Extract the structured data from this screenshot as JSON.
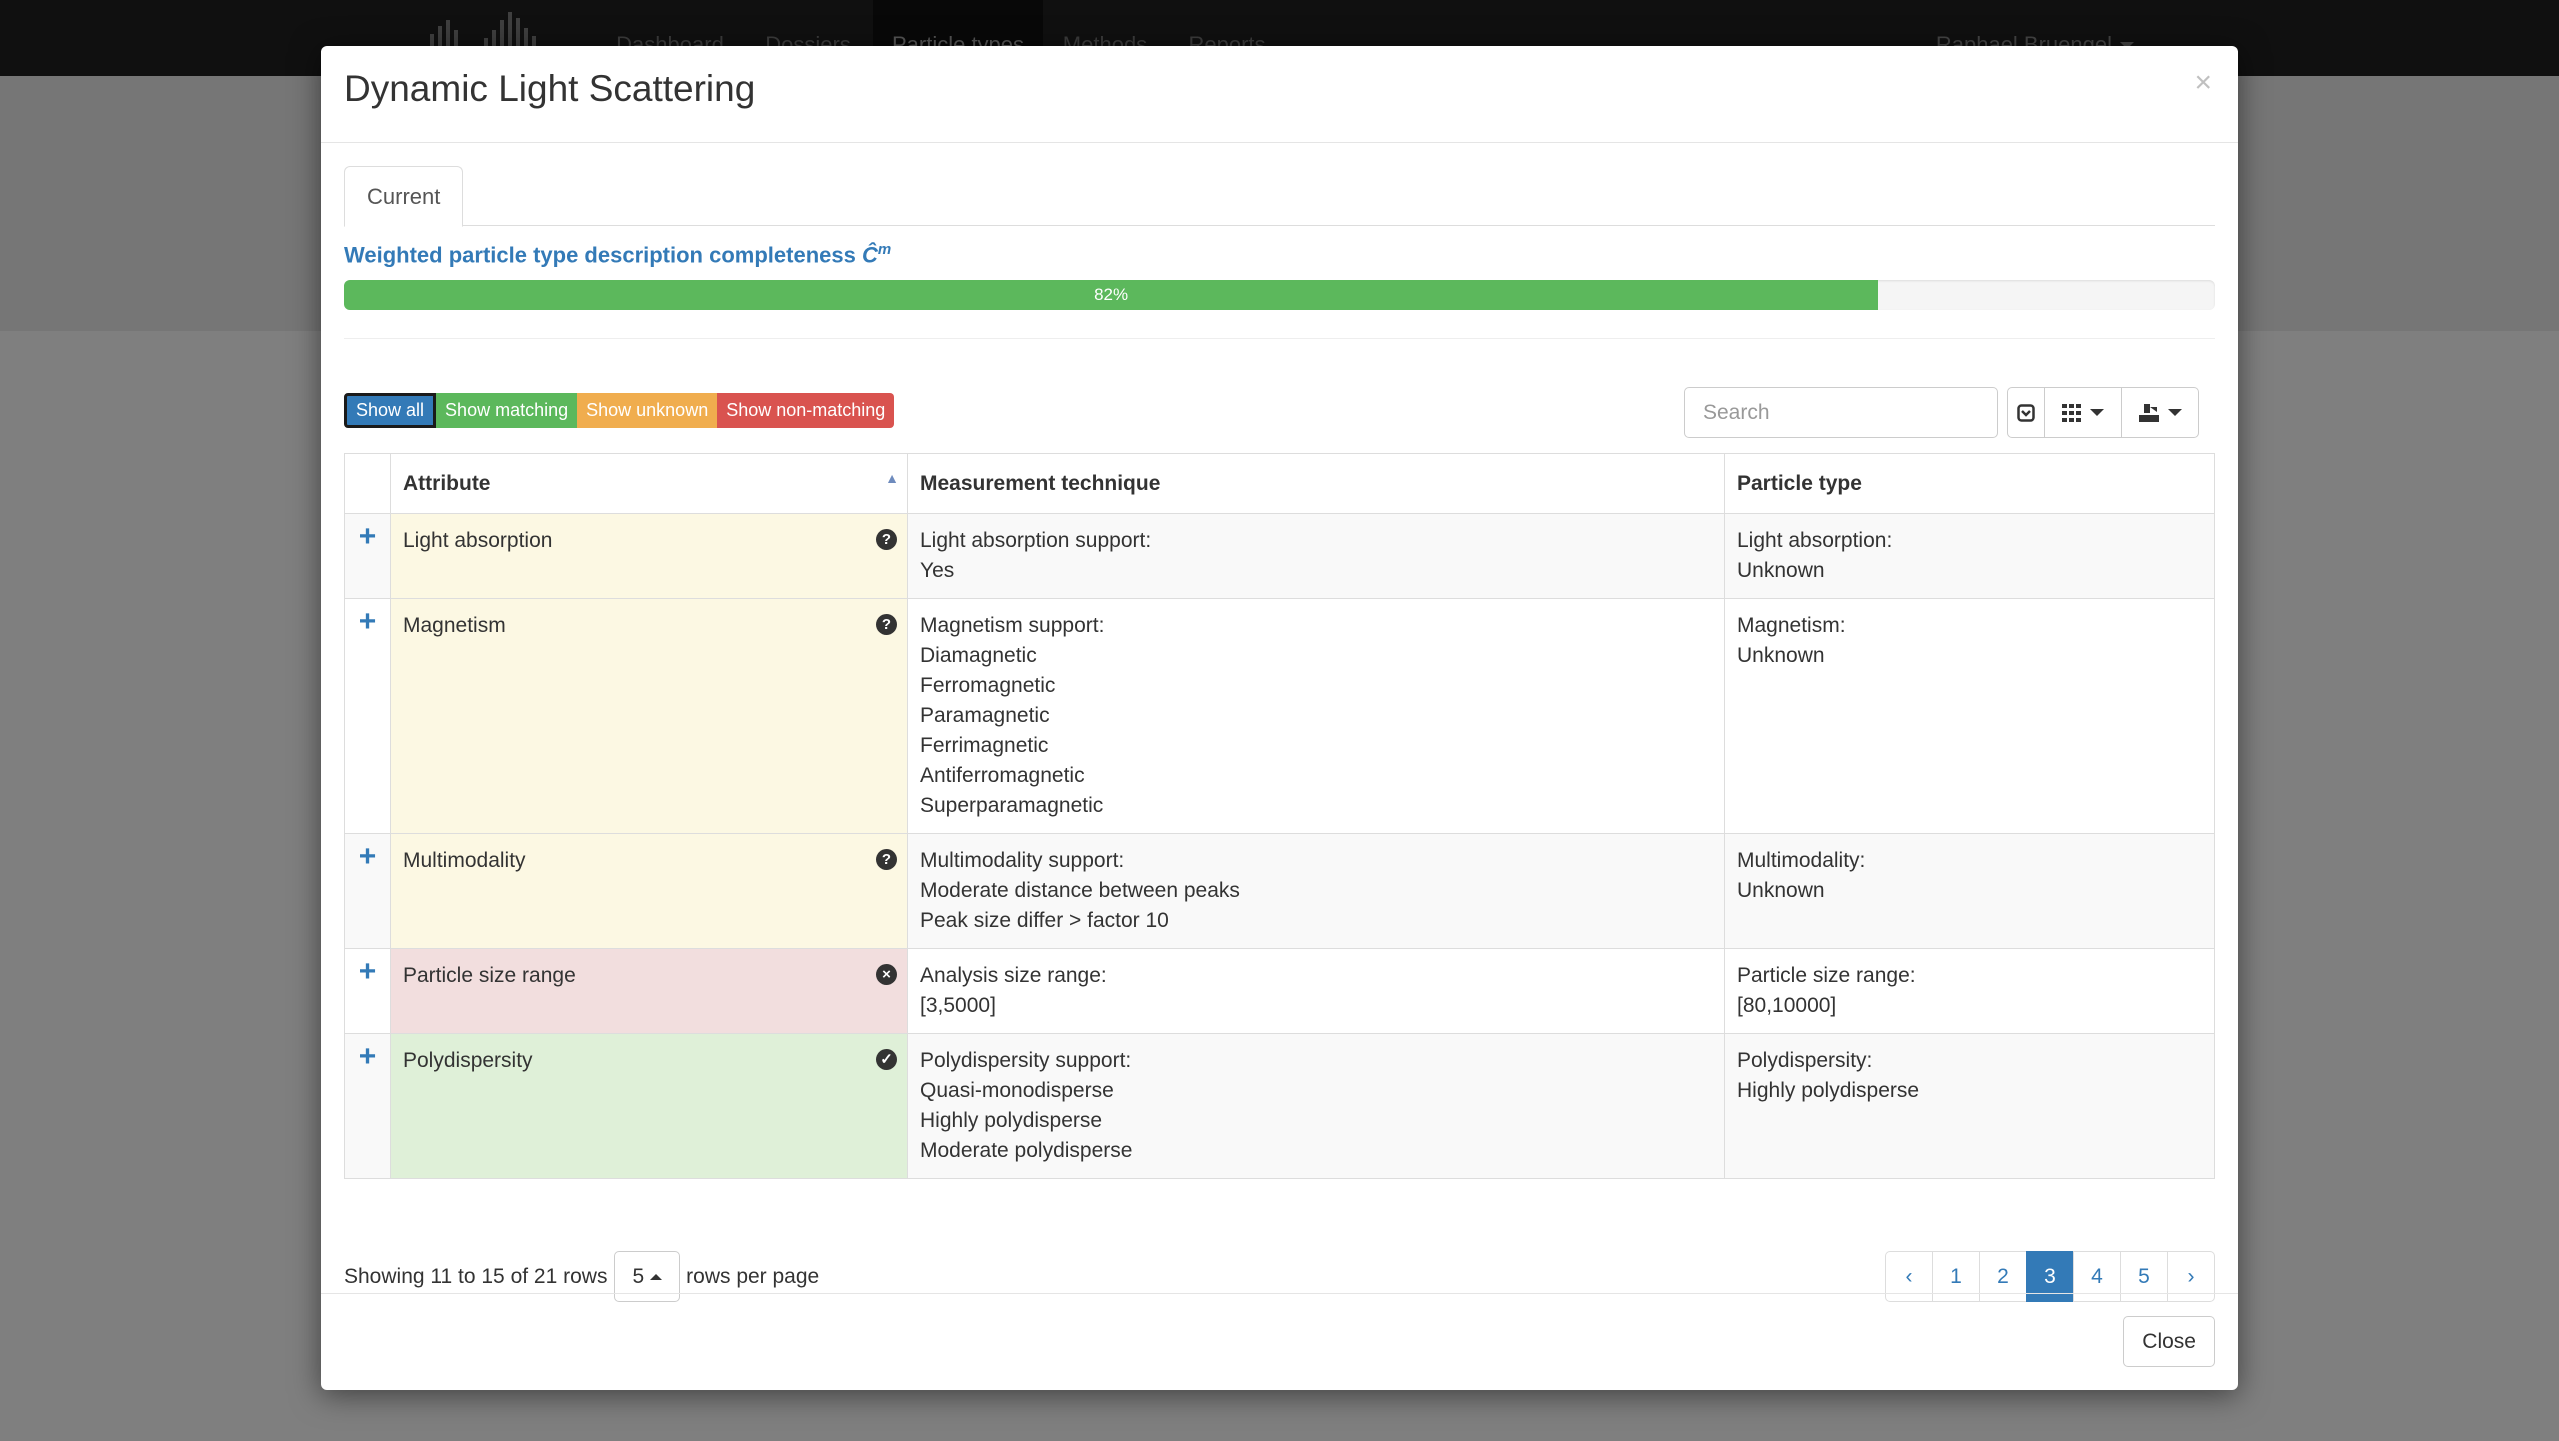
{
  "navbar": {
    "items": [
      "Dashboard",
      "Dossiers",
      "Particle types",
      "Methods",
      "Reports"
    ],
    "active_index": 2,
    "user": "Raphael Bruengel"
  },
  "modal": {
    "title": "Dynamic Light Scattering",
    "close_x": "×",
    "tab": "Current",
    "completeness_label": "Weighted particle type description completeness",
    "completeness_symbol": "Ĉ",
    "completeness_sup": "m",
    "progress_percent": 82,
    "progress_label": "82%",
    "filters": {
      "show_all": "Show all",
      "show_matching": "Show matching",
      "show_unknown": "Show unknown",
      "show_non_matching": "Show non-matching"
    },
    "search_placeholder": "Search",
    "table": {
      "headers": {
        "attribute": "Attribute",
        "measurement": "Measurement technique",
        "particle": "Particle type"
      },
      "rows": [
        {
          "attribute": "Light absorption",
          "status": "unknown",
          "measurement": [
            "Light absorption support:",
            "Yes"
          ],
          "particle": [
            "Light absorption:",
            "Unknown"
          ]
        },
        {
          "attribute": "Magnetism",
          "status": "unknown",
          "measurement": [
            "Magnetism support:",
            "Diamagnetic",
            "Ferromagnetic",
            "Paramagnetic",
            "Ferrimagnetic",
            "Antiferromagnetic",
            "Superparamagnetic"
          ],
          "particle": [
            "Magnetism:",
            "Unknown"
          ]
        },
        {
          "attribute": "Multimodality",
          "status": "unknown",
          "measurement": [
            "Multimodality support:",
            "Moderate distance between peaks",
            "Peak size differ > factor 10"
          ],
          "particle": [
            "Multimodality:",
            "Unknown"
          ]
        },
        {
          "attribute": "Particle size range",
          "status": "non-matching",
          "measurement": [
            "Analysis size range:",
            "[3,5000]"
          ],
          "particle": [
            "Particle size range:",
            "[80,10000]"
          ]
        },
        {
          "attribute": "Polydispersity",
          "status": "matching",
          "measurement": [
            "Polydispersity support:",
            "Quasi-monodisperse",
            "Highly polydisperse",
            "Moderate polydisperse"
          ],
          "particle": [
            "Polydispersity:",
            "Highly polydisperse"
          ]
        }
      ]
    },
    "pagination": {
      "showing": "Showing 11 to 15 of 21 rows",
      "page_size": "5",
      "rows_per_page": "rows per page",
      "prev": "‹",
      "next": "›",
      "pages": [
        "1",
        "2",
        "3",
        "4",
        "5"
      ],
      "active_page": "3"
    },
    "footer_close": "Close"
  },
  "colors": {
    "primary": "#337ab7",
    "success": "#5cb85c",
    "warning": "#f0ad4e",
    "danger": "#d9534f",
    "row_unknown": "#fcf8e3",
    "row_non_matching": "#f2dede",
    "row_matching": "#dff0d8"
  },
  "icons": {
    "unknown": "question-circle-icon",
    "non-matching": "times-circle-icon",
    "matching": "check-circle-icon",
    "expand": "plus-icon",
    "toggle": "toggle-icon",
    "columns": "grid-icon",
    "export": "export-icon"
  }
}
